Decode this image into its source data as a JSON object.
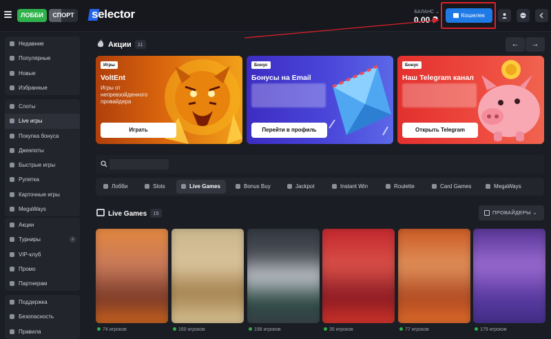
{
  "header": {
    "lobby_tab": "ЛОББИ",
    "sport_tab": "СПОРТ",
    "logo_text": "selector",
    "balance_label": "БАЛАНС ⌄",
    "balance_value": "0.00 ₽",
    "wallet_button": "Кошелек"
  },
  "sidebar": {
    "group1": [
      {
        "label": "Недавние",
        "icon": "clock-icon"
      },
      {
        "label": "Популярные",
        "icon": "star-icon"
      },
      {
        "label": "Новые",
        "icon": "diamond-icon"
      },
      {
        "label": "Избранные",
        "icon": "heart-icon"
      }
    ],
    "group2": [
      {
        "label": "Слоты",
        "icon": "slots-icon"
      },
      {
        "label": "Live игры",
        "icon": "live-icon",
        "active": true
      },
      {
        "label": "Покупка бонуса",
        "icon": "bonus-icon"
      },
      {
        "label": "Джекпоты",
        "icon": "jackpot-icon"
      },
      {
        "label": "Быстрые игры",
        "icon": "fast-games-icon"
      },
      {
        "label": "Рулетка",
        "icon": "roulette-icon"
      },
      {
        "label": "Карточные игры",
        "icon": "cards-icon"
      },
      {
        "label": "MegaWays",
        "icon": "megaways-icon"
      }
    ],
    "group3": [
      {
        "label": "Акции",
        "icon": "gift-icon"
      },
      {
        "label": "Турниры",
        "icon": "trophy-icon",
        "chevron": "›"
      },
      {
        "label": "VIP-клуб",
        "icon": "crown-icon"
      },
      {
        "label": "Промо",
        "icon": "promo-icon"
      },
      {
        "label": "Партнерам",
        "icon": "partners-icon"
      }
    ],
    "group4": [
      {
        "label": "Поддержка",
        "icon": "support-icon"
      },
      {
        "label": "Безопасность",
        "icon": "shield-icon"
      },
      {
        "label": "Правила",
        "icon": "rules-icon"
      }
    ]
  },
  "promotions": {
    "title": "Акции",
    "count": "11",
    "prev": "←",
    "next": "→",
    "cards": [
      {
        "tag": "Игры",
        "title": "VoltEnt",
        "description": "Игры от непревзойденного провайдера",
        "button": "Играть"
      },
      {
        "tag": "Бонус",
        "title": "Бонусы на Email",
        "button": "Перейти в профиль"
      },
      {
        "tag": "Бонус",
        "title": "Наш Telegram канал",
        "button": "Открыть Telegram"
      }
    ]
  },
  "categories": [
    {
      "label": "Лобби"
    },
    {
      "label": "Slots"
    },
    {
      "label": "Live Games",
      "active": true
    },
    {
      "label": "Bonus Buy"
    },
    {
      "label": "Jackpot"
    },
    {
      "label": "Instant Win"
    },
    {
      "label": "Roulette"
    },
    {
      "label": "Card Games"
    },
    {
      "label": "MegaWays"
    }
  ],
  "live_games": {
    "title": "Live Games",
    "count": "15",
    "providers_button": "ПРОВАЙДЕРЫ ⌄",
    "tiles": [
      {
        "players": "74 игроков"
      },
      {
        "players": "160 игроков"
      },
      {
        "players": "198 игроков"
      },
      {
        "players": "35 игроков"
      },
      {
        "players": "77 игроков"
      },
      {
        "players": "179 игроков"
      }
    ]
  },
  "colors": {
    "accent_green": "#2fb24b",
    "wallet_blue": "#1f7ae6",
    "highlight_red": "#e0202a",
    "background": "#1b1d24"
  }
}
